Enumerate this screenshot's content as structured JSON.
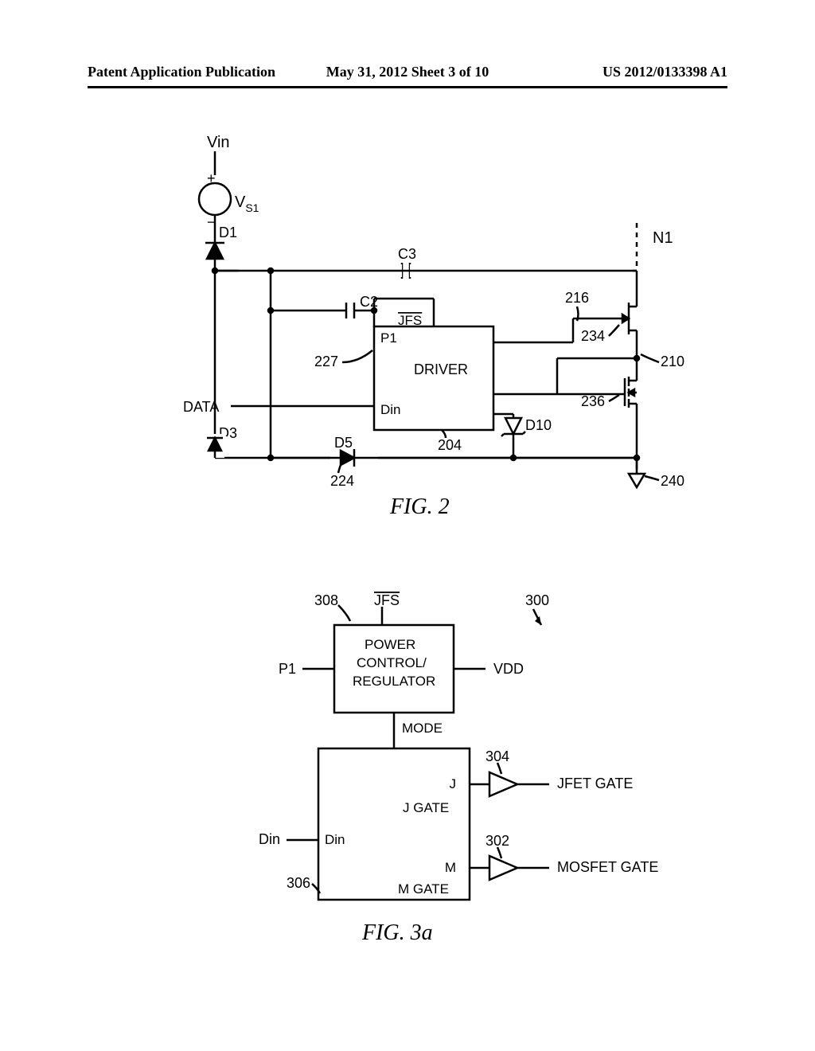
{
  "header": {
    "left": "Patent Application Publication",
    "center": "May 31, 2012  Sheet 3 of 10",
    "right": "US 2012/0133398 A1"
  },
  "fig2": {
    "caption": "FIG. 2",
    "vin": "Vin",
    "vs1": "V",
    "vs1_sub": "S1",
    "plus": "+",
    "minus": "−",
    "d1": "D1",
    "c3": "C3",
    "n1": "N1",
    "c2": "C2",
    "jfs": "JFS",
    "p1": "P1",
    "driver": "DRIVER",
    "l216": "216",
    "l234": "234",
    "l210": "210",
    "l227": "227",
    "data": "DATA",
    "din_port": "Din",
    "l236": "236",
    "d3": "D3",
    "d5": "D5",
    "l224": "224",
    "l204": "204",
    "d10": "D10",
    "l240": "240"
  },
  "fig3a": {
    "caption": "FIG. 3a",
    "jfs": "JFS",
    "l308": "308",
    "l300": "300",
    "p1": "P1",
    "pcr1": "POWER",
    "pcr2": "CONTROL/",
    "pcr3": "REGULATOR",
    "vdd": "VDD",
    "mode": "MODE",
    "l304": "304",
    "j": "J",
    "jgate_port": "J GATE",
    "jfet_gate": "JFET GATE",
    "l302": "302",
    "m": "M",
    "mgate_port": "M GATE",
    "mosfet_gate": "MOSFET GATE",
    "din": "Din",
    "din_port": "Din",
    "l306": "306"
  }
}
